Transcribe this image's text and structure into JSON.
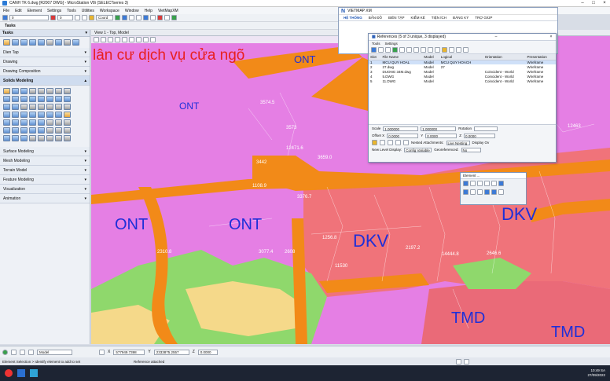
{
  "window": {
    "title": "CANH TK 6.dwg [R2007 DWG] - MicroStation V8i (SELECTseries 3)"
  },
  "menu": [
    "File",
    "Edit",
    "Element",
    "Settings",
    "Tools",
    "Utilities",
    "Workspace",
    "Window",
    "Help",
    "VietMapXM"
  ],
  "toolbar": {
    "level_value": "0",
    "color_value": "0",
    "coords_label": "Coord"
  },
  "left_panel": {
    "tasks_title": "Tasks",
    "tasks_combo": "Tasks",
    "sections": [
      {
        "label": "Dien Tap",
        "open": false
      },
      {
        "label": "Drawing",
        "open": false
      },
      {
        "label": "Drawing Composition",
        "open": false
      },
      {
        "label": "Solids Modeling",
        "open": true
      },
      {
        "label": "Surface Modeling",
        "open": false
      },
      {
        "label": "Mesh Modeling",
        "open": false
      },
      {
        "label": "Terrain Model",
        "open": false
      },
      {
        "label": "Feature Modeling",
        "open": false
      },
      {
        "label": "Visualization",
        "open": false
      },
      {
        "label": "Animation",
        "open": false
      }
    ]
  },
  "view": {
    "title": "View 1 - Top, Model",
    "heading_text": "lân cư dịch vụ cửa ngõ",
    "labels": [
      "ONT",
      "ONT",
      "ONT",
      "ONT",
      "DKV",
      "DKV",
      "TMD",
      "TMD"
    ],
    "numbers": [
      "3574.5",
      "3573",
      "12471.6",
      "3442",
      "3659.0",
      "1108.9",
      "3376.7",
      "1256.8",
      "2197.2",
      "14444.8",
      "11530",
      "2646.6",
      "12463",
      "3077.4",
      "2608",
      "2310.8"
    ]
  },
  "ribbon": {
    "title": "VIETMAP XM",
    "tabs": [
      "HỆ THỐNG",
      "BẢN ĐỒ",
      "BIÊN TẬP",
      "KIỂM KÊ",
      "TIỆN ÍCH",
      "ĐĂNG KÝ",
      "TRỢ GIÚP"
    ]
  },
  "references": {
    "title": "References (5 of 3 unique, 3 displayed)",
    "menu": [
      "Tools",
      "Settings"
    ],
    "columns": [
      "Slot",
      "File Name",
      "Model",
      "Logical",
      "Orientation",
      "Presentation"
    ],
    "rows": [
      {
        "slot": "1",
        "file": "MCU QUY HOAL",
        "model": "Model",
        "logical": "MCU QUY HOACH",
        "orientation": "",
        "presentation": "Wireframe"
      },
      {
        "slot": "2",
        "file": "27.dwg",
        "model": "Model",
        "logical": "27",
        "orientation": "",
        "presentation": "Wireframe"
      },
      {
        "slot": "3",
        "file": "DUONG 34M.dwg",
        "model": "Model",
        "logical": "",
        "orientation": "Coincident - World",
        "presentation": "Wireframe"
      },
      {
        "slot": "4",
        "file": "5.DWG",
        "model": "Model",
        "logical": "",
        "orientation": "Coincident - World",
        "presentation": "Wireframe"
      },
      {
        "slot": "5",
        "file": "11.DWG",
        "model": "Model",
        "logical": "",
        "orientation": "Coincident - World",
        "presentation": "Wireframe"
      }
    ],
    "scale_label": "Scale",
    "scale_value1": "1.000000",
    "scale_value2": "1.000000",
    "rotation_label": "Rotation",
    "offset_label": "Offset X",
    "offset_x": "0.0000",
    "offset_y_label": "Y",
    "offset_y": "0.0000",
    "offset_z_label": "Z",
    "offset_z": "0.0000",
    "nested_label": "Nested Attachments:",
    "nested_value": "Live Nesting",
    "display_label": "Display Ov",
    "newlevel_label": "New Level Display:",
    "newlevel_value": "Config Variable",
    "georef_label": "Georeferenced:",
    "georef_value": "No"
  },
  "element_tool": {
    "title": "Element ..."
  },
  "status": {
    "model": "Model",
    "x_label": "X",
    "x_value": "577949.7398",
    "y_label": "Y",
    "y_value": "2333875.2557",
    "z_label": "Z",
    "z_value": "0.0000",
    "prompt": "Element Selection > Identify element to add to set",
    "message": "Reference attached"
  },
  "taskbar": {
    "time": "10:49 SA",
    "date": "27/09/2022"
  },
  "colors": {
    "map_magenta": "#e57fe4",
    "map_orange": "#f28a18",
    "map_salmon": "#f0737a",
    "map_green": "#8fd86c",
    "map_yellow": "#f5d98a",
    "label_blue": "#1e2fd8"
  }
}
